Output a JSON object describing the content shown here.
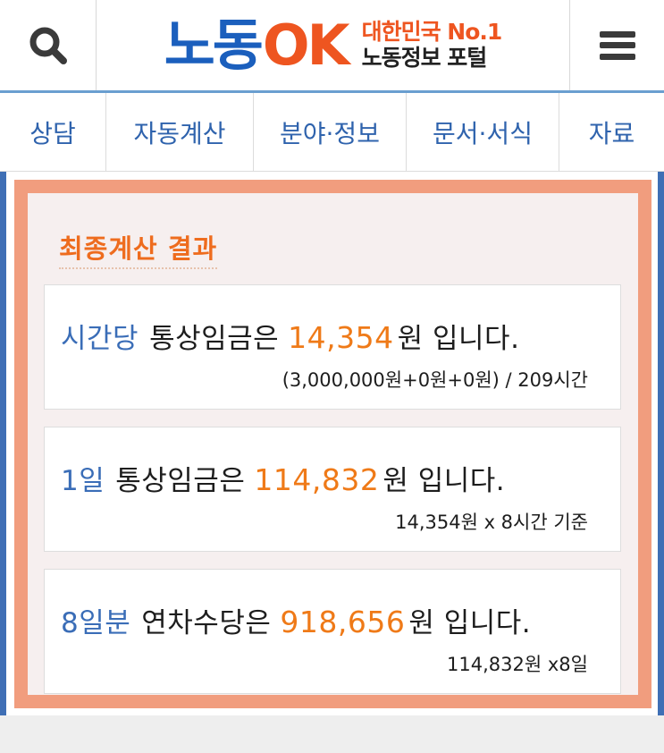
{
  "header": {
    "logo_ko": "노동",
    "logo_ok": "OK",
    "logo_tagline_top": "대한민국 No.1",
    "logo_tagline_bottom": "노동정보 포털",
    "search_icon": "search-icon",
    "menu_icon": "hamburger-menu-icon"
  },
  "nav": {
    "items": [
      {
        "label": "상담"
      },
      {
        "label": "자동계산"
      },
      {
        "label": "분야·정보"
      },
      {
        "label": "문서·서식"
      },
      {
        "label": "자료"
      }
    ]
  },
  "result": {
    "title": "최종계산 결과",
    "cards": [
      {
        "prefix": "시간당",
        "subject": "통상임금은",
        "amount": "14,354",
        "suffix": "원 입니다.",
        "detail": "(3,000,000원+0원+0원) / 209시간"
      },
      {
        "prefix": "1일",
        "subject": "통상임금은",
        "amount": "114,832",
        "suffix": "원 입니다.",
        "detail": "14,354원 x 8시간 기준"
      },
      {
        "prefix": "8일분",
        "subject": "연차수당은",
        "amount": "918,656",
        "suffix": "원 입니다.",
        "detail": "114,832원 x8일"
      }
    ]
  },
  "colors": {
    "brand_blue": "#1b5fbd",
    "brand_orange": "#ee5520",
    "nav_text": "#2f63ad",
    "amount": "#ef7a18",
    "box_border": "#f19d7e"
  }
}
